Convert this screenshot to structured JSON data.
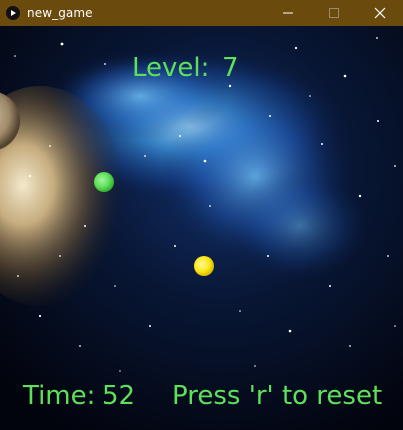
{
  "window": {
    "title": "new_game",
    "icon": "play-icon",
    "controls": [
      "minimize-icon",
      "maximize-icon",
      "close-icon"
    ]
  },
  "hud": {
    "level_label": "Level:",
    "level_value": "7",
    "time_label": "Time:",
    "time_value": "52",
    "reset_hint": "Press 'r' to reset"
  },
  "colors": {
    "titlebar": "#6b4a0e",
    "hud_text": "#5fe05a",
    "player_ball": "#5fe05a",
    "target_ball": "#ffe81a",
    "space": "#05091a",
    "nebula": "#3a8fd8"
  },
  "entities": {
    "player": {
      "name": "green-ball"
    },
    "target": {
      "name": "yellow-ball"
    }
  }
}
